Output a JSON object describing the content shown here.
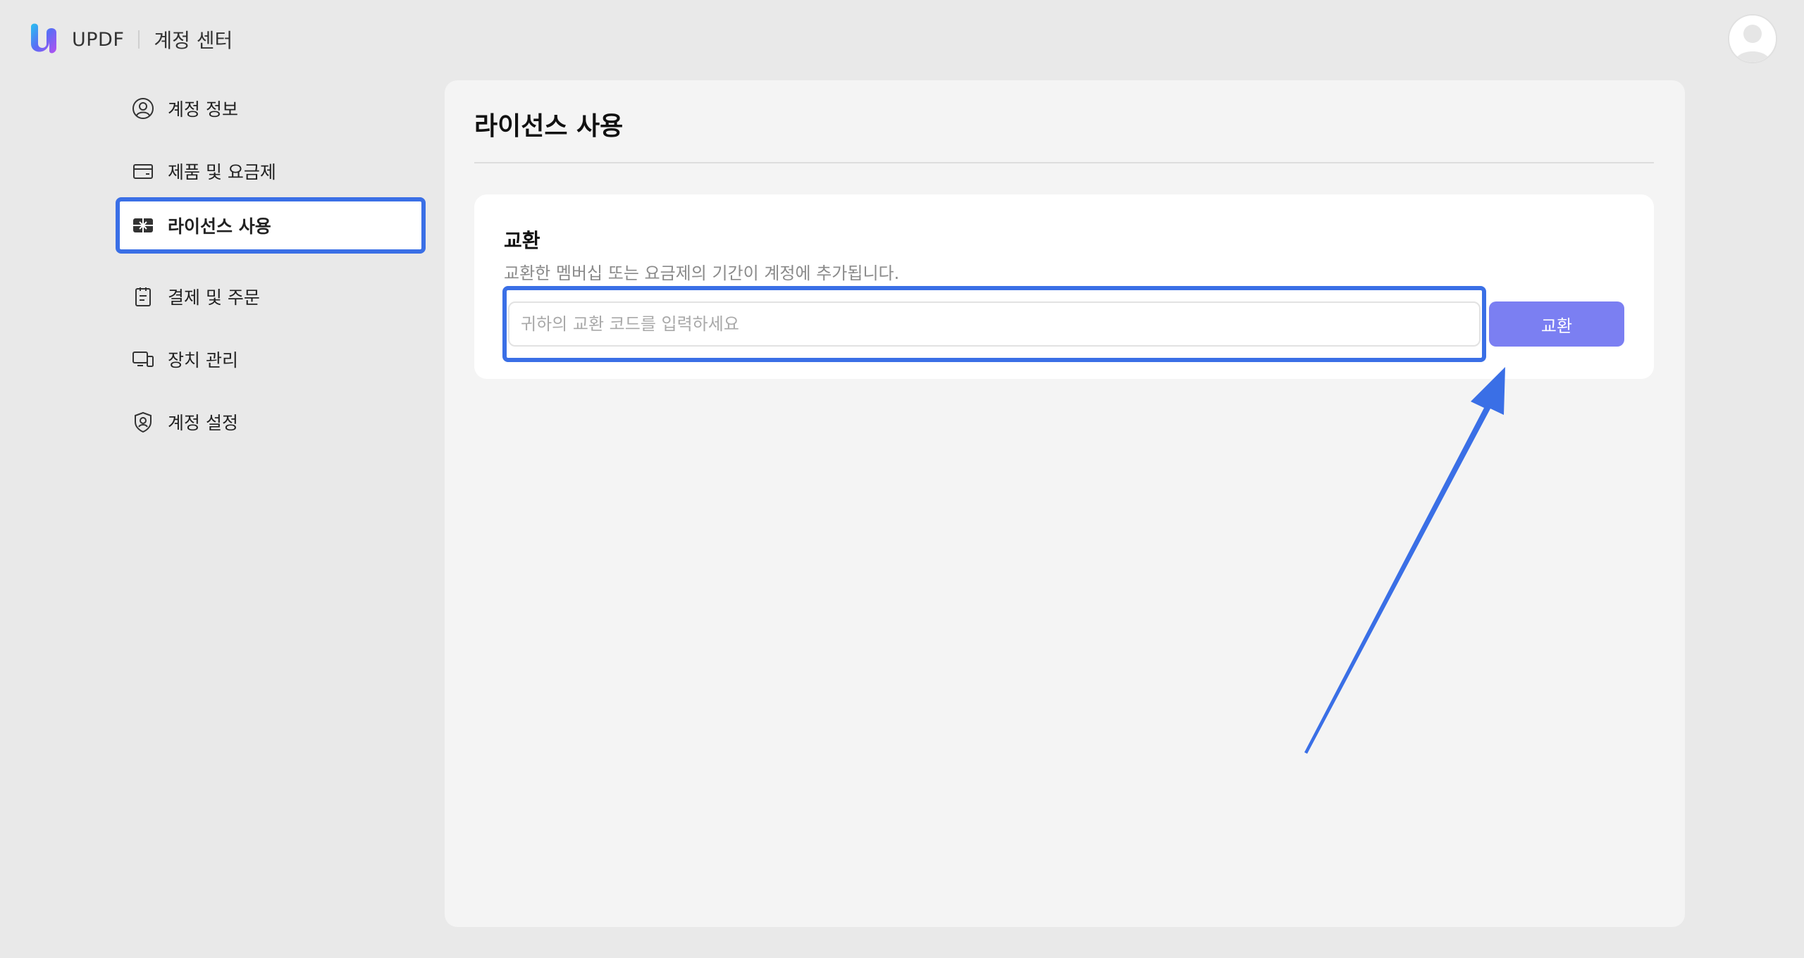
{
  "header": {
    "brand": "UPDF",
    "section_title": "계정 센터",
    "logo_icon": "updf-logo-icon",
    "avatar_icon": "user-avatar-icon"
  },
  "sidebar": {
    "items": [
      {
        "label": "계정 정보",
        "icon": "user-circle-icon",
        "active": false
      },
      {
        "label": "제품 및 요금제",
        "icon": "credit-card-icon",
        "active": false
      },
      {
        "label": "라이선스 사용",
        "icon": "gift-card-icon",
        "active": true
      },
      {
        "label": "결제 및 주문",
        "icon": "clipboard-icon",
        "active": false
      },
      {
        "label": "장치 관리",
        "icon": "devices-icon",
        "active": false
      },
      {
        "label": "계정 설정",
        "icon": "shield-user-icon",
        "active": false
      }
    ]
  },
  "main": {
    "title": "라이선스 사용",
    "redeem_card": {
      "title": "교환",
      "description": "교환한 멤버십 또는 요금제의 기간이 계정에 추가됩니다.",
      "input_placeholder": "귀하의 교환 코드를 입력하세요",
      "input_value": "",
      "button_label": "교환"
    }
  },
  "colors": {
    "highlight": "#3a6fe6",
    "button": "#7b7ff2",
    "background": "#e9e9e9",
    "panel": "#f4f4f4"
  }
}
